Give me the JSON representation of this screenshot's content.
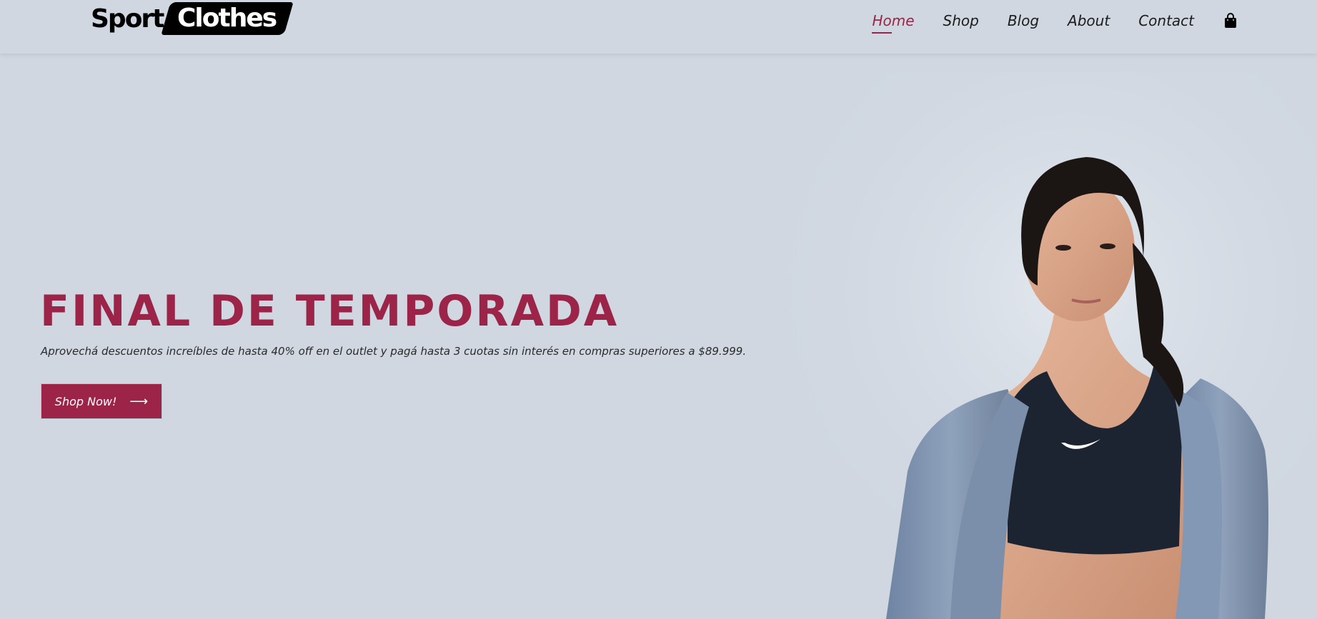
{
  "brand": {
    "word1": "Sport",
    "word2": "Clothes"
  },
  "nav": {
    "items": [
      {
        "label": "Home",
        "active": true
      },
      {
        "label": "Shop"
      },
      {
        "label": "Blog"
      },
      {
        "label": "About"
      },
      {
        "label": "Contact"
      }
    ],
    "cart_icon": "shopping-bag-icon"
  },
  "hero": {
    "title": "FINAL DE TEMPORADA",
    "subtitle": "Aprovechá descuentos increíbles de hasta 40% off en el outlet y pagá hasta 3 cuotas sin interés en compras superiores a $89.999.",
    "cta_label": "Shop Now!",
    "cta_arrow": "⟶"
  },
  "colors": {
    "accent": "#9b2448",
    "background": "#d0d7e1",
    "text": "#1c1c1c"
  }
}
